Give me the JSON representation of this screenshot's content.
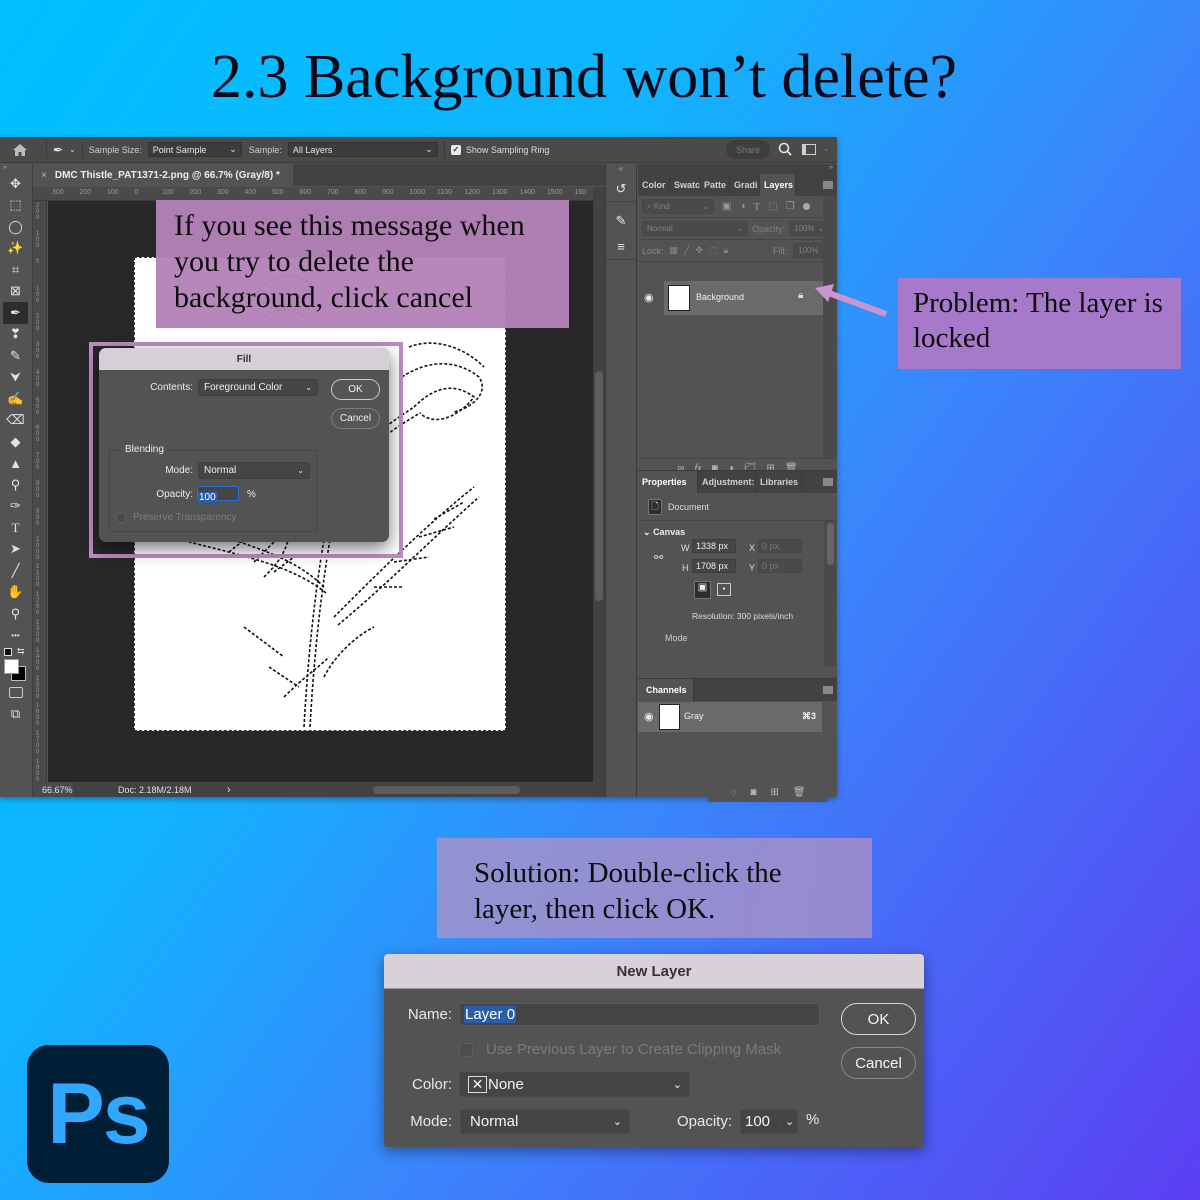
{
  "title": "2.3 Background won’t delete?",
  "photoshop": {
    "options_bar": {
      "home_icon": "home-icon",
      "tool_icon": "eyedropper-icon",
      "sample_size_label": "Sample Size:",
      "sample_size_value": "Point Sample",
      "sample_label": "Sample:",
      "sample_value": "All Layers",
      "show_sampling_ring_label": "Show Sampling Ring",
      "show_sampling_ring_checked": true,
      "share_label": "Share"
    },
    "document_tab": {
      "close": "×",
      "title": "DMC Thistle_PAT1371-2.png @ 66.7% (Gray/8) *"
    },
    "ruler_h": [
      "300",
      "200",
      "100",
      "0",
      "100",
      "200",
      "300",
      "400",
      "500",
      "600",
      "700",
      "800",
      "900",
      "1000",
      "1100",
      "1200",
      "1300",
      "1400",
      "1500",
      "160"
    ],
    "ruler_v": [
      "200",
      "100",
      "0",
      "100",
      "200",
      "300",
      "400",
      "500",
      "600",
      "700",
      "800",
      "900",
      "1000",
      "1100",
      "1200",
      "1300",
      "1400",
      "1500",
      "1600",
      "1700",
      "1800"
    ],
    "tools": [
      {
        "name": "move-tool",
        "glyph": "✥"
      },
      {
        "name": "marquee-tool",
        "glyph": "⬚"
      },
      {
        "name": "lasso-tool",
        "glyph": "◯"
      },
      {
        "name": "magic-wand-tool",
        "glyph": "✨"
      },
      {
        "name": "crop-tool",
        "glyph": "⌗"
      },
      {
        "name": "frame-tool",
        "glyph": "⊠"
      },
      {
        "name": "eyedropper-tool",
        "glyph": "✒"
      },
      {
        "name": "healing-brush-tool",
        "glyph": "❣"
      },
      {
        "name": "brush-tool",
        "glyph": "✎"
      },
      {
        "name": "clone-stamp-tool",
        "glyph": "⮟"
      },
      {
        "name": "history-brush-tool",
        "glyph": "✍"
      },
      {
        "name": "eraser-tool",
        "glyph": "⌫"
      },
      {
        "name": "paint-bucket-tool",
        "glyph": "◆"
      },
      {
        "name": "blur-tool",
        "glyph": "▲"
      },
      {
        "name": "dodge-tool",
        "glyph": "⚲"
      },
      {
        "name": "pen-tool",
        "glyph": "✑"
      },
      {
        "name": "type-tool",
        "glyph": "T"
      },
      {
        "name": "path-selection-tool",
        "glyph": "➤"
      },
      {
        "name": "line-tool",
        "glyph": "╱"
      },
      {
        "name": "hand-tool",
        "glyph": "✋"
      },
      {
        "name": "zoom-tool",
        "glyph": "⚲"
      },
      {
        "name": "more-tools",
        "glyph": "•••"
      }
    ],
    "status": {
      "zoom": "66.67%",
      "doc": "Doc: 2.18M/2.18M",
      "arrow": "›"
    },
    "layers_panel": {
      "tabs": [
        "Color",
        "Swatc",
        "Patte",
        "Gradi",
        "Layers"
      ],
      "active_tab": "Layers",
      "filter_label": "Kind",
      "blend_mode": "Normal",
      "opacity_label": "Opacity:",
      "opacity_value": "100%",
      "lock_label": "Lock:",
      "fill_label": "Fill:",
      "fill_value": "100%",
      "layers": [
        {
          "name": "Background",
          "visible": true,
          "locked": true
        }
      ]
    },
    "properties_panel": {
      "tabs": [
        "Properties",
        "Adjustment:",
        "Libraries"
      ],
      "active_tab": "Properties",
      "doc_label": "Document",
      "canvas_label": "Canvas",
      "w_label": "W",
      "w_value": "1338 px",
      "h_label": "H",
      "h_value": "1708 px",
      "x_label": "X",
      "x_value": "0 px",
      "y_label": "Y",
      "y_value": "0 px",
      "resolution": "Resolution: 300 pixels/inch",
      "mode_label": "Mode"
    },
    "channels_panel": {
      "tab": "Channels",
      "channels": [
        {
          "name": "Gray",
          "shortcut": "⌘3",
          "visible": true
        }
      ]
    }
  },
  "fill_dialog": {
    "title": "Fill",
    "contents_label": "Contents:",
    "contents_value": "Foreground Color",
    "ok": "OK",
    "cancel": "Cancel",
    "blending_label": "Blending",
    "mode_label": "Mode:",
    "mode_value": "Normal",
    "opacity_label": "Opacity:",
    "opacity_value": "100",
    "percent": "%",
    "preserve_transparency_label": "Preserve Transparency",
    "preserve_transparency_checked": false
  },
  "callouts": {
    "top": "If you see this message when you try to delete the background, click cancel",
    "problem": "Problem: The layer is locked",
    "solution": "Solution: Double-click the layer, then click OK."
  },
  "new_layer_dialog": {
    "title": "New Layer",
    "name_label": "Name:",
    "name_value": "Layer 0",
    "clipping_mask_label": "Use Previous Layer to Create Clipping Mask",
    "clipping_mask_checked": false,
    "color_label": "Color:",
    "color_value": "None",
    "mode_label": "Mode:",
    "mode_value": "Normal",
    "opacity_label": "Opacity:",
    "opacity_value": "100",
    "percent": "%",
    "ok": "OK",
    "cancel": "Cancel"
  },
  "logo": {
    "text": "Ps"
  },
  "colors": {
    "callout_purple": "#b482b9",
    "problem_purple": "#a679cb",
    "ps_blue": "#31a8ff",
    "ps_navy": "#001e36",
    "selection_blue": "#2a5fa8"
  }
}
